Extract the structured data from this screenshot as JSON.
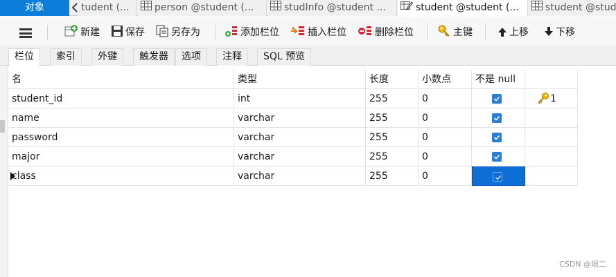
{
  "tabs": {
    "objects_label": "对象",
    "items": [
      {
        "label": "tudent (...",
        "icon": "table-icon"
      },
      {
        "label": "person @student (...",
        "icon": "table-icon"
      },
      {
        "label": "studInfo @student ...",
        "icon": "table-icon"
      },
      {
        "label": "student @student (...",
        "icon": "design-table-icon"
      },
      {
        "label": "student @stude",
        "icon": "table-icon"
      }
    ]
  },
  "toolbar": {
    "new": "新建",
    "save": "保存",
    "save_as": "另存为",
    "add_field": "添加栏位",
    "insert_field": "插入栏位",
    "delete_field": "删除栏位",
    "primary_key": "主键",
    "move_up": "上移",
    "move_down": "下移"
  },
  "subtabs": [
    "栏位",
    "索引",
    "外键",
    "触发器",
    "选项",
    "注释",
    "SQL 预览"
  ],
  "grid": {
    "headers": [
      "名",
      "类型",
      "长度",
      "小数点",
      "不是 null",
      ""
    ],
    "rows": [
      {
        "name": "student_id",
        "type": "int",
        "length": "255",
        "decimals": "0",
        "not_null": true,
        "key": "1"
      },
      {
        "name": "name",
        "type": "varchar",
        "length": "255",
        "decimals": "0",
        "not_null": true,
        "key": ""
      },
      {
        "name": "password",
        "type": "varchar",
        "length": "255",
        "decimals": "0",
        "not_null": true,
        "key": ""
      },
      {
        "name": "major",
        "type": "varchar",
        "length": "255",
        "decimals": "0",
        "not_null": true,
        "key": ""
      },
      {
        "name": "class",
        "type": "varchar",
        "length": "255",
        "decimals": "0",
        "not_null": true,
        "key": ""
      }
    ]
  },
  "watermark": "CSDN @垠二",
  "colors": {
    "accent": "#0c7dd8",
    "selection": "#0d6fd6"
  }
}
